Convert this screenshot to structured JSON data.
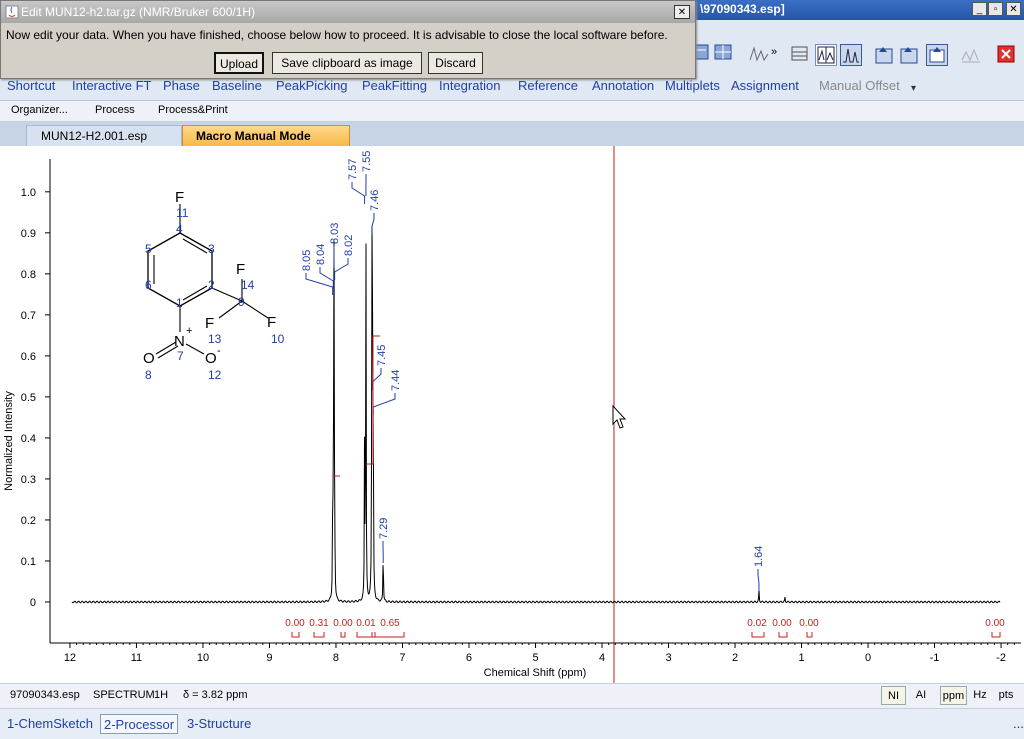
{
  "app": {
    "title_fragment": "\\97090343.esp]",
    "window_buttons": [
      "_",
      "▫",
      "✕"
    ]
  },
  "dialog": {
    "title": "Edit MUN12-h2.tar.gz (NMR/Bruker 600/1H)",
    "close": "✕",
    "message": "Now edit your data. When you have finished, choose below how to proceed. It is advisable to close the local software before.",
    "buttons": {
      "upload": "Upload",
      "save_clipboard": "Save clipboard as image",
      "discard": "Discard"
    }
  },
  "menu": {
    "items": [
      "Shortcut",
      "Interactive FT",
      "Phase",
      "Baseline",
      "PeakPicking",
      "PeakFitting",
      "Integration",
      "Reference",
      "Annotation",
      "Multiplets",
      "Assignment",
      "Manual Offset"
    ],
    "more": "▾"
  },
  "subtoolbar": {
    "items": [
      "Organizer...",
      "Process",
      "Process&Print"
    ]
  },
  "tabs": [
    {
      "label": "MUN12-H2.001.esp"
    },
    {
      "label": "Macro Manual Mode"
    }
  ],
  "colors": {
    "accent": "#1f3fa8",
    "integral": "#cc1e1e",
    "peak_label": "#1f3fa8",
    "cursor": "#c0201c",
    "spectrum": "#000000",
    "tab_active": "#f7b84a"
  },
  "molecule": {
    "atoms": [
      "F",
      "11",
      "4",
      "3",
      "5",
      "6",
      "2",
      "1",
      "F",
      "14",
      "9",
      "F",
      "F",
      "13",
      "10",
      "N",
      "+",
      "7",
      "O",
      "8",
      "O",
      "-",
      "12"
    ]
  },
  "chart_data": {
    "type": "line",
    "xlabel": "Chemical Shift (ppm)",
    "ylabel": "Normalized Intensity",
    "xlim": [
      12.3,
      -2.3
    ],
    "ylim": [
      -0.1,
      1.08
    ],
    "x_ticks": [
      "12",
      "11",
      "10",
      "9",
      "8",
      "7",
      "6",
      "5",
      "4",
      "3",
      "2",
      "1",
      "0",
      "-1",
      "-2"
    ],
    "y_ticks": [
      "0",
      "0.1",
      "0.2",
      "0.3",
      "0.4",
      "0.5",
      "0.6",
      "0.7",
      "0.8",
      "0.9",
      "1.0"
    ],
    "peaks": [
      {
        "ppm": 8.05,
        "h": 0.19
      },
      {
        "ppm": 8.04,
        "h": 0.33
      },
      {
        "ppm": 8.03,
        "h": 0.8
      },
      {
        "ppm": 8.02,
        "h": 0.22
      },
      {
        "ppm": 7.57,
        "h": 0.4
      },
      {
        "ppm": 7.55,
        "h": 0.96
      },
      {
        "ppm": 7.46,
        "h": 0.92
      },
      {
        "ppm": 7.45,
        "h": 0.55
      },
      {
        "ppm": 7.44,
        "h": 0.5
      },
      {
        "ppm": 7.29,
        "h": 0.14
      },
      {
        "ppm": 1.64,
        "h": 0.028
      },
      {
        "ppm": 1.25,
        "h": 0.012
      }
    ],
    "peak_labels": [
      "8.05",
      "8.04",
      "8.03",
      "8.02",
      "7.57",
      "7.55",
      "7.46",
      "7.45",
      "7.44",
      "7.29",
      "1.64"
    ],
    "integrals": [
      "0.00",
      "0.31",
      "0.00",
      "0.01",
      "0.65",
      "0.02",
      "0.00",
      "0.00",
      "0.00"
    ],
    "cursor_ppm": 3.82
  },
  "status": {
    "file": "97090343.esp",
    "type": "SPECTRUM",
    "nucleus": "1H",
    "delta": "δ = 3.82 ppm",
    "buttons": [
      "NI",
      "AI",
      "ppm",
      "Hz",
      "pts"
    ]
  },
  "tasks": [
    "1-ChemSketch",
    "2-Processor",
    "3-Structure"
  ],
  "more_dots": "..."
}
